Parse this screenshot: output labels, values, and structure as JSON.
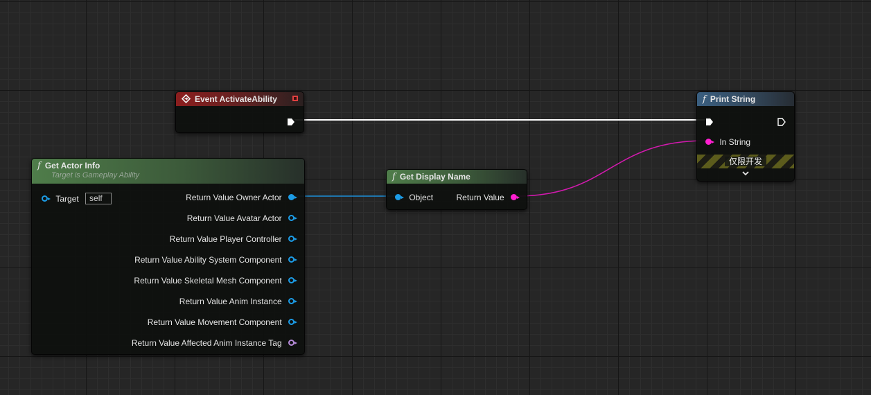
{
  "nodes": {
    "event_activate": {
      "title": "Event ActivateAbility"
    },
    "print_string": {
      "title": "Print String",
      "in_string_label": "In String",
      "dev_only_label": "仅限开发"
    },
    "get_actor_info": {
      "title": "Get Actor Info",
      "subtitle": "Target is Gameplay Ability",
      "target_label": "Target",
      "target_value": "self",
      "outputs": [
        "Return Value Owner Actor",
        "Return Value Avatar Actor",
        "Return Value Player Controller",
        "Return Value Ability System Component",
        "Return Value Skeletal Mesh Component",
        "Return Value Anim Instance",
        "Return Value Movement Component",
        "Return Value Affected Anim Instance Tag"
      ]
    },
    "get_display_name": {
      "title": "Get Display Name",
      "object_label": "Object",
      "return_label": "Return Value"
    }
  },
  "colors": {
    "object_pin": "#1c9ce6",
    "string_pin": "#ff1fd0",
    "struct_pin": "#b58ad8",
    "exec_wire": "#ffffff"
  }
}
